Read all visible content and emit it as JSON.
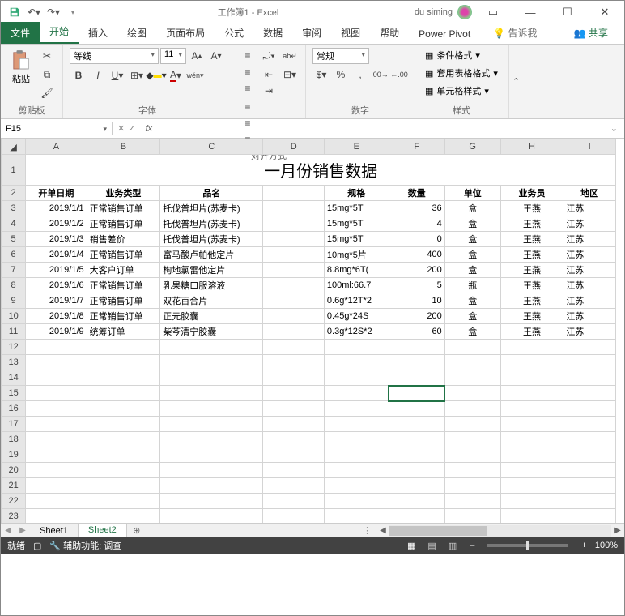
{
  "titlebar": {
    "doc": "工作簿1 - Excel",
    "user": "du siming"
  },
  "tabs": {
    "file": "文件",
    "home": "开始",
    "insert": "插入",
    "draw": "绘图",
    "layout": "页面布局",
    "formula": "公式",
    "data": "数据",
    "review": "审阅",
    "view": "视图",
    "help": "帮助",
    "pivot": "Power Pivot",
    "tell": "告诉我",
    "share": "共享"
  },
  "ribbon": {
    "clipboard": {
      "paste": "粘贴",
      "group": "剪贴板"
    },
    "font": {
      "name": "等线",
      "size": "11",
      "group": "字体"
    },
    "align": {
      "group": "对齐方式"
    },
    "number": {
      "format": "常规",
      "group": "数字"
    },
    "styles": {
      "cond": "条件格式",
      "table": "套用表格格式",
      "cell": "单元格样式",
      "group": "样式"
    }
  },
  "nb": {
    "cell": "F15"
  },
  "title": "一月份销售数据",
  "headers": {
    "A": "开单日期",
    "B": "业务类型",
    "C": "品名",
    "D": "",
    "E": "规格",
    "F": "数量",
    "G": "单位",
    "H": "业务员",
    "I": "地区"
  },
  "rows": [
    {
      "A": "2019/1/1",
      "B": "正常销售订单",
      "C": "托伐普坦片(苏麦卡)",
      "E": "15mg*5T",
      "F": "36",
      "G": "盒",
      "H": "王燕",
      "I": "江苏"
    },
    {
      "A": "2019/1/2",
      "B": "正常销售订单",
      "C": "托伐普坦片(苏麦卡)",
      "E": "15mg*5T",
      "F": "4",
      "G": "盒",
      "H": "王燕",
      "I": "江苏"
    },
    {
      "A": "2019/1/3",
      "B": "销售差价",
      "C": "托伐普坦片(苏麦卡)",
      "E": "15mg*5T",
      "F": "0",
      "G": "盒",
      "H": "王燕",
      "I": "江苏"
    },
    {
      "A": "2019/1/4",
      "B": "正常销售订单",
      "C": "富马酸卢帕他定片",
      "E": "10mg*5片",
      "F": "400",
      "G": "盒",
      "H": "王燕",
      "I": "江苏"
    },
    {
      "A": "2019/1/5",
      "B": "大客户订单",
      "C": "枸地氯雷他定片",
      "E": "8.8mg*6T(",
      "F": "200",
      "G": "盒",
      "H": "王燕",
      "I": "江苏"
    },
    {
      "A": "2019/1/6",
      "B": "正常销售订单",
      "C": "乳果糖口服溶液",
      "E": "100ml:66.7",
      "F": "5",
      "G": "瓶",
      "H": "王燕",
      "I": "江苏"
    },
    {
      "A": "2019/1/7",
      "B": "正常销售订单",
      "C": "双花百合片",
      "E": "0.6g*12T*2",
      "F": "10",
      "G": "盒",
      "H": "王燕",
      "I": "江苏"
    },
    {
      "A": "2019/1/8",
      "B": "正常销售订单",
      "C": "正元胶囊",
      "E": "0.45g*24S",
      "F": "200",
      "G": "盒",
      "H": "王燕",
      "I": "江苏"
    },
    {
      "A": "2019/1/9",
      "B": "统筹订单",
      "C": "柴芩清宁胶囊",
      "E": "0.3g*12S*2",
      "F": "60",
      "G": "盒",
      "H": "王燕",
      "I": "江苏"
    }
  ],
  "sheets": {
    "s1": "Sheet1",
    "s2": "Sheet2"
  },
  "status": {
    "ready": "就绪",
    "acc": "辅助功能: 调查",
    "zoom": "100%"
  }
}
